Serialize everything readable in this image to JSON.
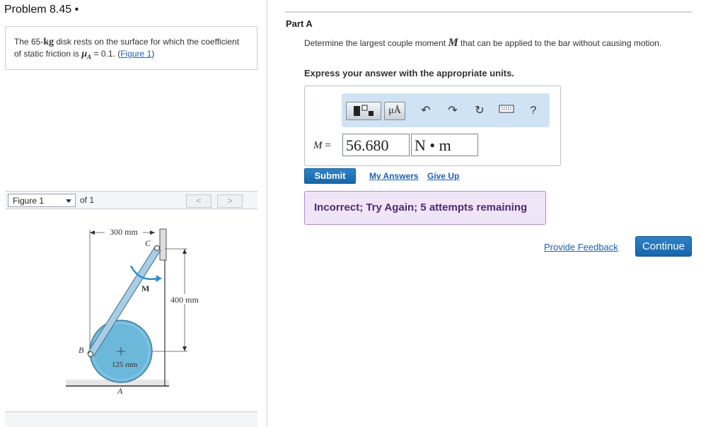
{
  "problem": {
    "title": "Problem 8.45 •",
    "text_1": "The 65-",
    "mass_unit": "kg",
    "text_2": " disk rests on the surface for which the coefficient of static friction is ",
    "mu_symbol": "μ",
    "mu_sub": "A",
    "text_3": " = 0.1. (",
    "figure_link": "Figure 1",
    "text_4": ")"
  },
  "figure_nav": {
    "selected": "Figure 1",
    "of_label": "of 1",
    "prev": "<",
    "next": ">"
  },
  "figure": {
    "dim_width": "300 mm",
    "dim_height": "400 mm",
    "dim_radius": "125 mm",
    "label_C": "C",
    "label_M": "M",
    "label_B": "B",
    "label_A": "A",
    "colors": {
      "disk": "#6bb8db",
      "bar": "#a9cde5",
      "arrow": "#2a8fd0",
      "line": "#333333"
    }
  },
  "part": {
    "title": "Part A",
    "question_1": "Determine the largest couple moment ",
    "question_var": "M",
    "question_2": " that can be applied to the bar without causing motion.",
    "instruction": "Express your answer with the appropriate units."
  },
  "answer": {
    "label_var": "M",
    "label_eq": " =",
    "value": "56.680",
    "unit": "N • m",
    "toolbar": {
      "units_label": "μÅ",
      "help": "?",
      "icons": [
        "templates-icon",
        "units-icon",
        "undo-icon",
        "redo-icon",
        "reset-icon",
        "keyboard-icon",
        "help-icon"
      ]
    }
  },
  "actions": {
    "submit": "Submit",
    "my_answers": "My Answers",
    "give_up": "Give Up"
  },
  "feedback": {
    "message": "Incorrect; Try Again; 5 attempts remaining",
    "provide_feedback": "Provide Feedback",
    "continue": "Continue"
  }
}
